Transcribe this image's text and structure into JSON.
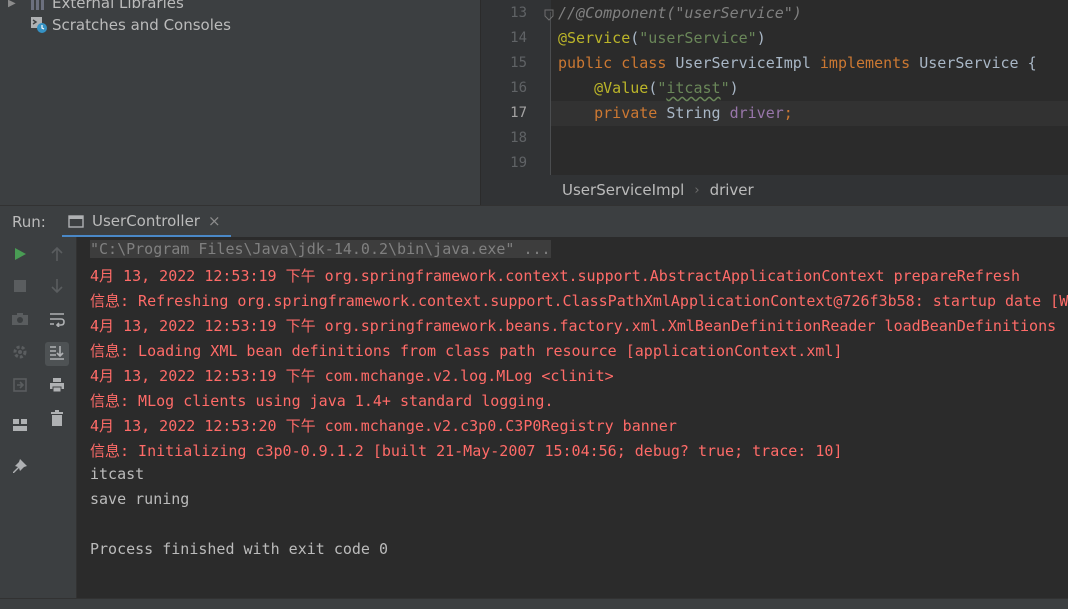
{
  "project_tree": {
    "items": [
      {
        "label": "External Libraries",
        "icon": "library-icon"
      },
      {
        "label": "Scratches and Consoles",
        "icon": "scratches-icon"
      }
    ]
  },
  "editor": {
    "lines": [
      {
        "number": "13"
      },
      {
        "number": "14"
      },
      {
        "number": "15"
      },
      {
        "number": "16"
      },
      {
        "number": "17"
      },
      {
        "number": "18"
      },
      {
        "number": "19"
      }
    ],
    "code": {
      "l13": "//@Component(\"userService\")",
      "l14_ann": "@Service",
      "l14_open": "(",
      "l14_str": "\"userService\"",
      "l14_close": ")",
      "l15_kw1": "public class ",
      "l15_name": "UserServiceImpl ",
      "l15_kw2": "implements ",
      "l15_rest": "UserService {",
      "l16_ann": "@Value",
      "l16_open": "(",
      "l16_str1": "\"",
      "l16_str2": "itcast",
      "l16_str3": "\"",
      "l16_close": ")",
      "l17_kw": "private ",
      "l17_type": "String ",
      "l17_field": "driver",
      "l17_semi": ";"
    }
  },
  "breadcrumb": {
    "items": [
      "UserServiceImpl",
      "driver"
    ],
    "separator": "›"
  },
  "run_window": {
    "label": "Run:",
    "tab_label": "UserController",
    "close_glyph": "×"
  },
  "console": {
    "lines": [
      {
        "type": "cmd",
        "text": "\"C:\\Program Files\\Java\\jdk-14.0.2\\bin\\java.exe\" ..."
      },
      {
        "type": "err",
        "text": "4月 13, 2022 12:53:19 下午 org.springframework.context.support.AbstractApplicationContext prepareRefresh"
      },
      {
        "type": "err",
        "text": "信息: Refreshing org.springframework.context.support.ClassPathXmlApplicationContext@726f3b58: startup date [W"
      },
      {
        "type": "err",
        "text": "4月 13, 2022 12:53:19 下午 org.springframework.beans.factory.xml.XmlBeanDefinitionReader loadBeanDefinitions"
      },
      {
        "type": "err",
        "text": "信息: Loading XML bean definitions from class path resource [applicationContext.xml]"
      },
      {
        "type": "err",
        "text": "4月 13, 2022 12:53:19 下午 com.mchange.v2.log.MLog <clinit>"
      },
      {
        "type": "err",
        "text": "信息: MLog clients using java 1.4+ standard logging."
      },
      {
        "type": "err",
        "text": "4月 13, 2022 12:53:20 下午 com.mchange.v2.c3p0.C3P0Registry banner"
      },
      {
        "type": "err",
        "text": "信息: Initializing c3p0-0.9.1.2 [built 21-May-2007 15:04:56; debug? true; trace: 10]"
      },
      {
        "type": "out",
        "text": "itcast"
      },
      {
        "type": "out",
        "text": "save runing"
      },
      {
        "type": "out",
        "text": ""
      },
      {
        "type": "out",
        "text": "Process finished with exit code 0"
      }
    ]
  },
  "colors": {
    "background": "#2b2b2b",
    "panel": "#3c3f41",
    "error_text": "#ff6b68",
    "output_text": "#bbbbbb",
    "keyword": "#cc7832",
    "string": "#6a8759",
    "annotation": "#bbb529",
    "field": "#9876aa",
    "run_green": "#499c54"
  }
}
